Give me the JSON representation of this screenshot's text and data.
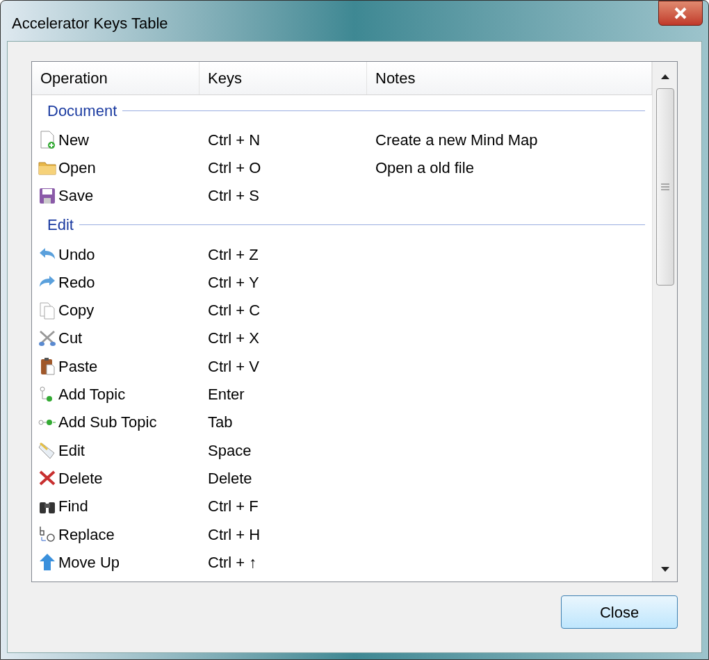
{
  "window": {
    "title": "Accelerator Keys Table"
  },
  "table": {
    "columns": [
      "Operation",
      "Keys",
      "Notes"
    ],
    "groups": [
      {
        "title": "Document",
        "rows": [
          {
            "operation": "New",
            "keys": "Ctrl + N",
            "notes": "Create a new Mind Map"
          },
          {
            "operation": "Open",
            "keys": "Ctrl + O",
            "notes": "Open a old file"
          },
          {
            "operation": "Save",
            "keys": "Ctrl + S"
          }
        ]
      },
      {
        "title": "Edit",
        "rows": [
          {
            "operation": "Undo",
            "keys": "Ctrl + Z"
          },
          {
            "operation": "Redo",
            "keys": "Ctrl + Y"
          },
          {
            "operation": "Copy",
            "keys": "Ctrl + C"
          },
          {
            "operation": "Cut",
            "keys": "Ctrl + X"
          },
          {
            "operation": "Paste",
            "keys": "Ctrl + V"
          },
          {
            "operation": "Add Topic",
            "keys": "Enter"
          },
          {
            "operation": "Add Sub Topic",
            "keys": "Tab"
          },
          {
            "operation": "Edit",
            "keys": "Space"
          },
          {
            "operation": "Delete",
            "keys": "Delete"
          },
          {
            "operation": "Find",
            "keys": "Ctrl + F"
          },
          {
            "operation": "Replace",
            "keys": "Ctrl + H"
          },
          {
            "operation": "Move Up",
            "keys": "Ctrl + ↑"
          }
        ]
      }
    ]
  },
  "buttons": [
    "Close"
  ]
}
